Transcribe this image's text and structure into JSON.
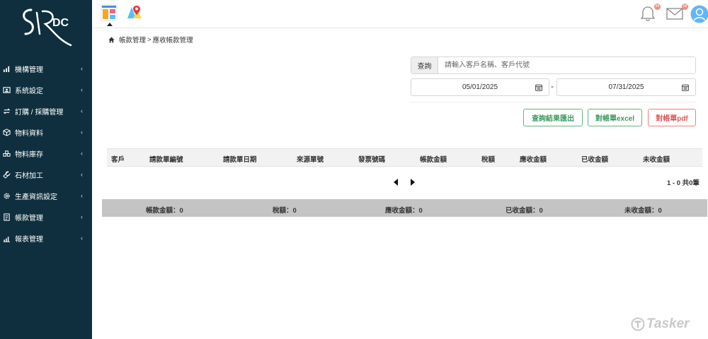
{
  "brand": {
    "logo_text": "DC"
  },
  "sidebar": {
    "items": [
      {
        "label": "機構管理",
        "icon": "bar-chart-icon"
      },
      {
        "label": "系統設定",
        "icon": "id-card-icon"
      },
      {
        "label": "訂購 / 採購管理",
        "icon": "exchange-icon"
      },
      {
        "label": "物料資料",
        "icon": "cube-icon"
      },
      {
        "label": "物料庫存",
        "icon": "warehouse-icon"
      },
      {
        "label": "石材加工",
        "icon": "wrench-icon"
      },
      {
        "label": "生產資訊設定",
        "icon": "gear-icon"
      },
      {
        "label": "帳款管理",
        "icon": "invoice-icon"
      },
      {
        "label": "報表管理",
        "icon": "report-icon"
      }
    ],
    "chevron": "‹"
  },
  "header": {
    "notification_badge": "88",
    "mail_badge": "98"
  },
  "breadcrumb": {
    "parent": "帳款管理",
    "separator": ">",
    "current": "應收帳款管理"
  },
  "search": {
    "label": "查詢",
    "placeholder": "請輸入客戶名稱、客戶代號"
  },
  "date_range": {
    "start": "05/01/2025",
    "separator": "-",
    "end": "07/31/2025"
  },
  "actions": {
    "export": "查詢結果匯出",
    "excel": "對帳單excel",
    "pdf": "對帳單pdf"
  },
  "table": {
    "columns": [
      "客戶",
      "請款單編號",
      "請款單日期",
      "來源單號",
      "發票號碼",
      "帳款金額",
      "稅額",
      "應收金額",
      "已收金額",
      "未收金額"
    ]
  },
  "pagination": {
    "summary": "1 - 0 共0筆"
  },
  "summary": {
    "account_amount": "帳款金額：0",
    "tax": "稅額：0",
    "receivable": "應收金額：0",
    "received": "已收金額：0",
    "outstanding": "未收金額：0"
  },
  "watermark": {
    "text": "Tasker"
  },
  "colors": {
    "sidebar": "#0f2f3f",
    "green": "#3f9a61",
    "red": "#e05a5a",
    "summary_bar": "#c4c4c4"
  }
}
